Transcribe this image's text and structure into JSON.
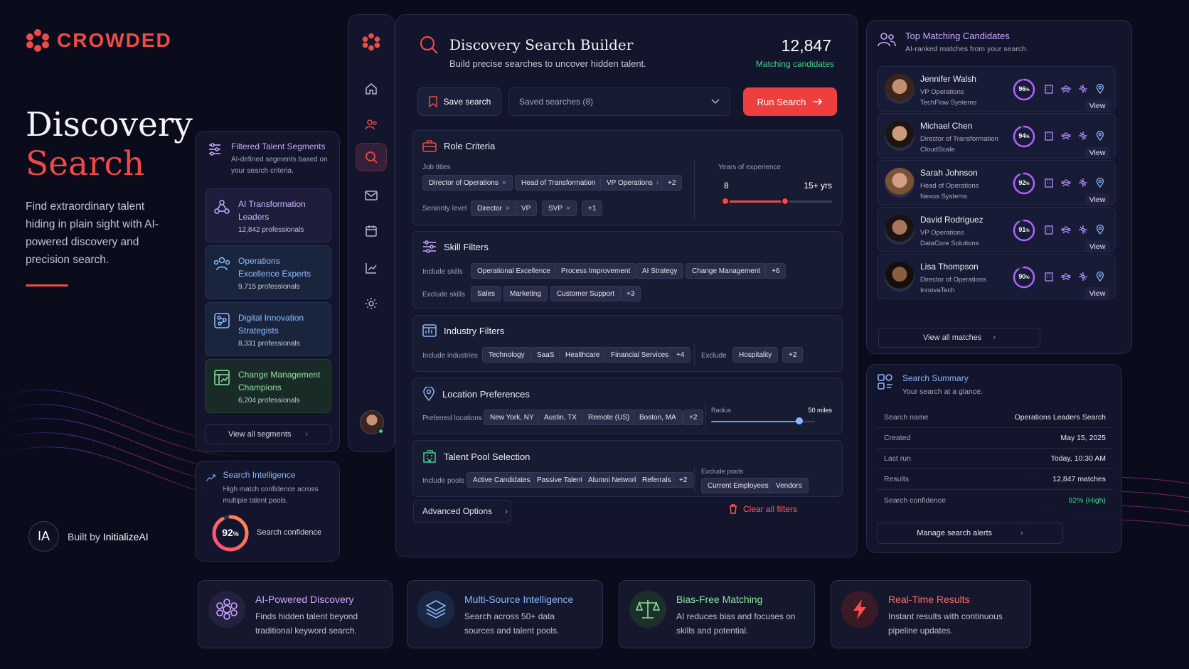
{
  "colors": {
    "accent": "#ef4a45",
    "purple": "#c9a8ff",
    "blue": "#8ab4ff",
    "green": "#3ed28a"
  },
  "brand": {
    "name": "CROWDED"
  },
  "hero": {
    "title_line1": "Discovery",
    "title_line2": "Search",
    "subtitle": "Find extraordinary talent hiding in plain sight with AI-powered discovery and precision search."
  },
  "built_by": {
    "badge": "IA",
    "prefix": "Built by",
    "name": "InitializeAI"
  },
  "segments": {
    "title": "Filtered Talent Segments",
    "desc": "AI-defined segments based on your search criteria.",
    "items": [
      {
        "label": "AI Transformation Leaders",
        "count": "12,842 professionals",
        "icon": "people-network-icon"
      },
      {
        "label": "Operations Excellence Experts",
        "count": "9,715 professionals",
        "icon": "people-group-icon"
      },
      {
        "label": "Digital Innovation Strategists",
        "count": "8,331 professionals",
        "icon": "network-icon"
      },
      {
        "label": "Change Management Champions",
        "count": "6,204 professionals",
        "icon": "grid-chart-icon"
      }
    ],
    "view_all": "View all segments"
  },
  "intelligence": {
    "title": "Search Intelligence",
    "desc": "High match confidence across multiple talent pools.",
    "confidence_pct": "92",
    "confidence_unit": "%",
    "confidence_value": 0.92,
    "confidence_label": "Search confidence"
  },
  "rail": {
    "items": [
      "logo",
      "home",
      "people",
      "search",
      "mail",
      "calendar",
      "analytics",
      "settings"
    ],
    "active": "search"
  },
  "builder": {
    "title": "Discovery Search Builder",
    "subtitle": "Build precise searches to uncover hidden talent.",
    "count": "12,847",
    "count_label": "Matching candidates",
    "save_label": "Save search",
    "saved_searches": "Saved searches (8)",
    "run_label": "Run Search",
    "role": {
      "title": "Role Criteria",
      "job_titles_label": "Job titles",
      "job_titles": [
        "Director of Operations",
        "Head of Transformation",
        "VP Operations"
      ],
      "job_titles_more": "+2",
      "seniority_label": "Seniority level",
      "seniority": [
        "Director",
        "VP",
        "SVP"
      ],
      "seniority_more": "+1",
      "years_label": "Years of experience",
      "years_min": "8",
      "years_max": "15+ yrs",
      "years_min_value": 8,
      "years_max_value": 15
    },
    "skills": {
      "title": "Skill Filters",
      "include_label": "Include skills",
      "include": [
        "Operational Excellence",
        "Process Improvement",
        "AI Strategy",
        "Change Management"
      ],
      "include_more": "+6",
      "exclude_label": "Exclude skills",
      "exclude": [
        "Sales",
        "Marketing",
        "Customer Support"
      ],
      "exclude_more": "+3"
    },
    "industry": {
      "title": "Industry Filters",
      "include_label": "Include industries",
      "include": [
        "Technology",
        "SaaS",
        "Healthcare",
        "Financial Services"
      ],
      "include_more": "+4",
      "exclude_label": "Exclude",
      "exclude": [
        "Hospitality"
      ],
      "exclude_more": "+2"
    },
    "location": {
      "title": "Location Preferences",
      "label": "Preferred locations",
      "items": [
        "New York, NY",
        "Austin, TX",
        "Remote (US)",
        "Boston, MA"
      ],
      "more": "+2",
      "radius_label": "Radius",
      "radius_value": "50 miles",
      "radius_fraction": 0.85
    },
    "pools": {
      "title": "Talent Pool Selection",
      "include_label": "Include pools",
      "include": [
        "Active Candidates",
        "Passive Talent",
        "Alumni Network",
        "Referrals"
      ],
      "include_more": "+2",
      "exclude_label": "Exclude pools",
      "exclude": [
        "Current Employees",
        "Vendors"
      ]
    },
    "advanced_label": "Advanced Options",
    "clear_label": "Clear all filters"
  },
  "top_matches": {
    "title": "Top Matching Candidates",
    "subtitle": "AI-ranked matches from your search.",
    "view_label": "View",
    "candidates": [
      {
        "name": "Jennifer Walsh",
        "role": "VP Operations",
        "company": "TechFlow Systems",
        "match": "96",
        "match_value": 0.96
      },
      {
        "name": "Michael Chen",
        "role": "Director of Transformation",
        "company": "CloudScale",
        "match": "94",
        "match_value": 0.94
      },
      {
        "name": "Sarah Johnson",
        "role": "Head of Operations",
        "company": "Nexus Systems",
        "match": "92",
        "match_value": 0.92
      },
      {
        "name": "David Rodriguez",
        "role": "VP Operations",
        "company": "DataCore Solutions",
        "match": "91",
        "match_value": 0.91
      },
      {
        "name": "Lisa Thompson",
        "role": "Director of Operations",
        "company": "InnovaTech",
        "match": "90",
        "match_value": 0.9
      }
    ],
    "view_all": "View all matches"
  },
  "summary": {
    "title": "Search Summary",
    "subtitle": "Your search at a glance.",
    "rows": [
      {
        "k": "Search name",
        "v": "Operations Leaders Search"
      },
      {
        "k": "Created",
        "v": "May 15, 2025"
      },
      {
        "k": "Last run",
        "v": "Today, 10:30 AM"
      },
      {
        "k": "Results",
        "v": "12,847 matches"
      },
      {
        "k": "Search confidence",
        "v": "92% (High)"
      }
    ],
    "manage_label": "Manage search alerts"
  },
  "features": [
    {
      "title": "AI-Powered Discovery",
      "desc": "Finds hidden talent beyond traditional keyword search.",
      "color": "#c9a8ff",
      "icon": "brain-icon"
    },
    {
      "title": "Multi-Source Intelligence",
      "desc": "Search across 50+ data sources and talent pools.",
      "color": "#8ab4ff",
      "icon": "layers-icon"
    },
    {
      "title": "Bias-Free Matching",
      "desc": "AI reduces bias and focuses on skills and potential.",
      "color": "#8ee3a1",
      "icon": "scale-icon"
    },
    {
      "title": "Real-Time Results",
      "desc": "Instant results with continuous pipeline updates.",
      "color": "#ff6b6b",
      "icon": "lightning-icon"
    }
  ]
}
